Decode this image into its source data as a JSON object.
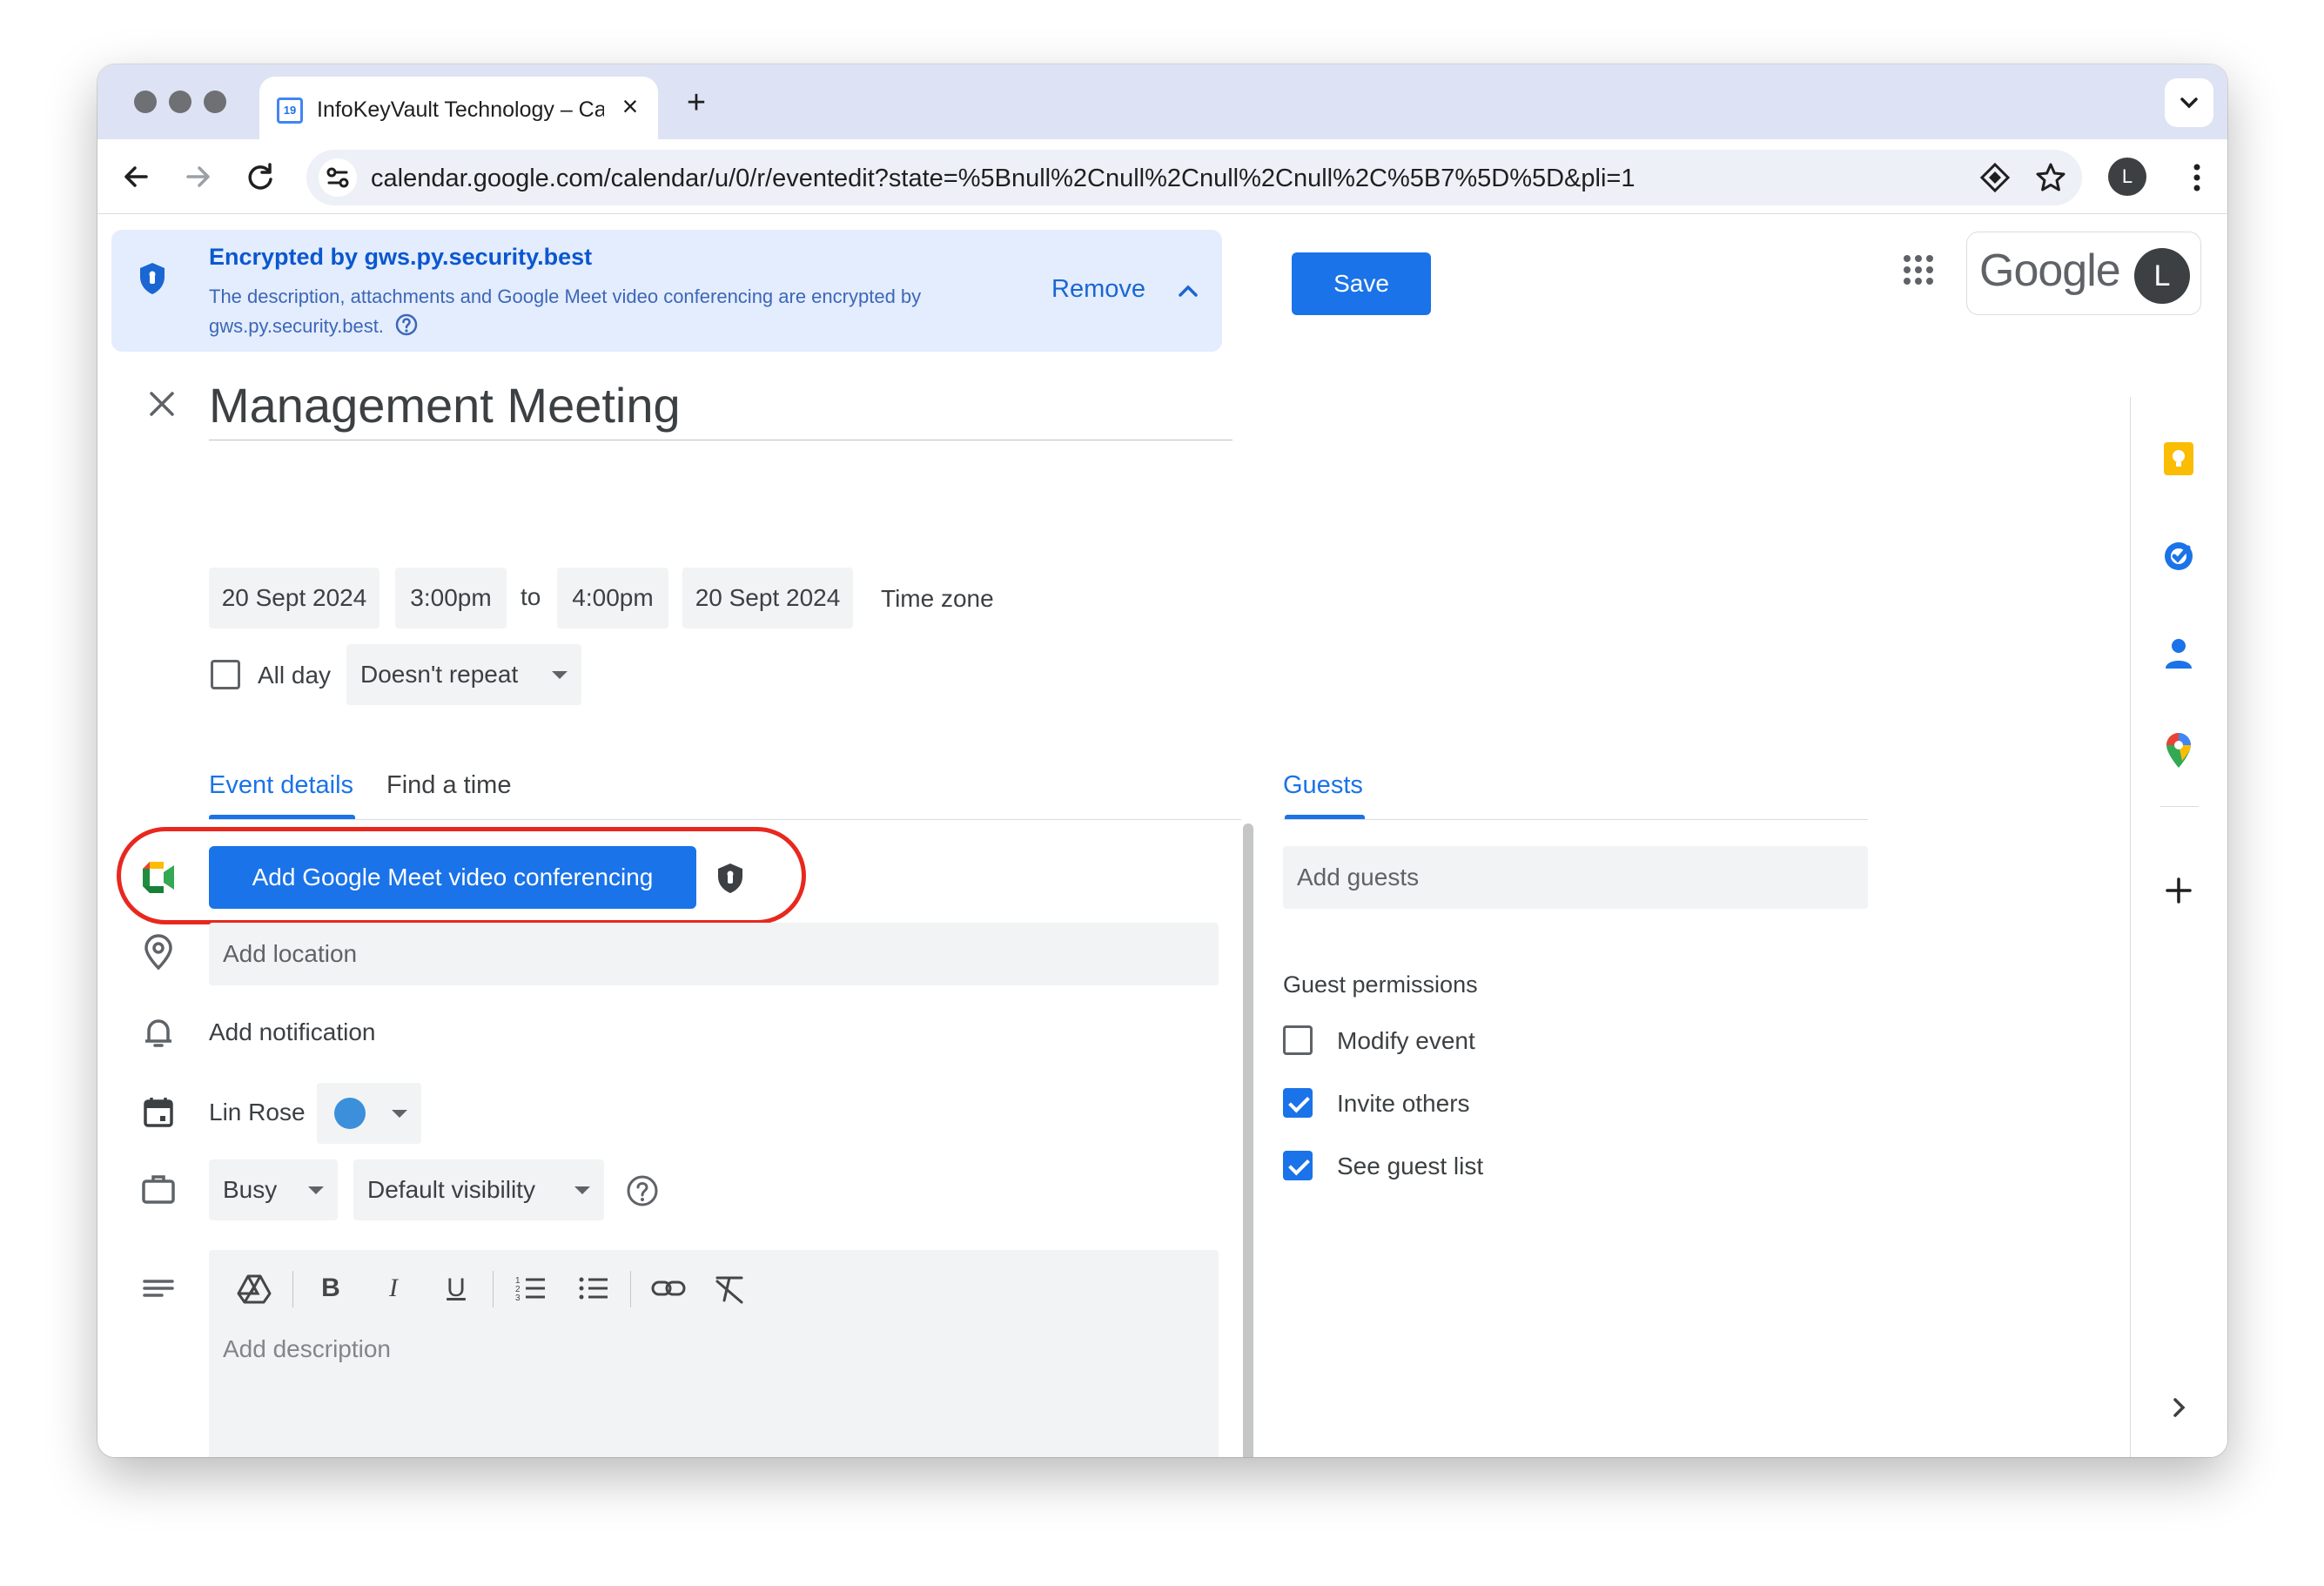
{
  "browser": {
    "tab_title": "InfoKeyVault Technology – Ca",
    "tab_favicon_text": "19",
    "url": "calendar.google.com/calendar/u/0/r/eventedit?state=%5Bnull%2Cnull%2Cnull%2Cnull%2C%5B7%5D%5D&pli=1",
    "profile_initial": "L"
  },
  "banner": {
    "title": "Encrypted by gws.py.security.best",
    "description": "The description, attachments and Google Meet video conferencing are encrypted by gws.py.security.best.",
    "remove_label": "Remove"
  },
  "header": {
    "save_label": "Save",
    "google_word": "Google",
    "account_initial": "L"
  },
  "event": {
    "title": "Management Meeting",
    "start_date": "20 Sept 2024",
    "start_time": "3:00pm",
    "to_label": "to",
    "end_time": "4:00pm",
    "end_date": "20 Sept 2024",
    "timezone_label": "Time zone",
    "all_day_label": "All day",
    "all_day_checked": false,
    "repeat_value": "Doesn't repeat"
  },
  "tabs": {
    "event_details": "Event details",
    "find_a_time": "Find a time",
    "guests": "Guests"
  },
  "details": {
    "meet_button": "Add Google Meet video conferencing",
    "location_placeholder": "Add location",
    "notification_label": "Add notification",
    "calendar_owner": "Lin Rose",
    "calendar_color": "#3b8fdb",
    "availability": "Busy",
    "visibility": "Default visibility",
    "description_placeholder": "Add description"
  },
  "guests": {
    "add_placeholder": "Add guests",
    "permissions_title": "Guest permissions",
    "permissions": [
      {
        "label": "Modify event",
        "checked": false
      },
      {
        "label": "Invite others",
        "checked": true
      },
      {
        "label": "See guest list",
        "checked": true
      }
    ]
  },
  "colors": {
    "accent": "#1a73e8",
    "highlight_ring": "#e8281e",
    "banner_bg": "#e4edfd"
  }
}
